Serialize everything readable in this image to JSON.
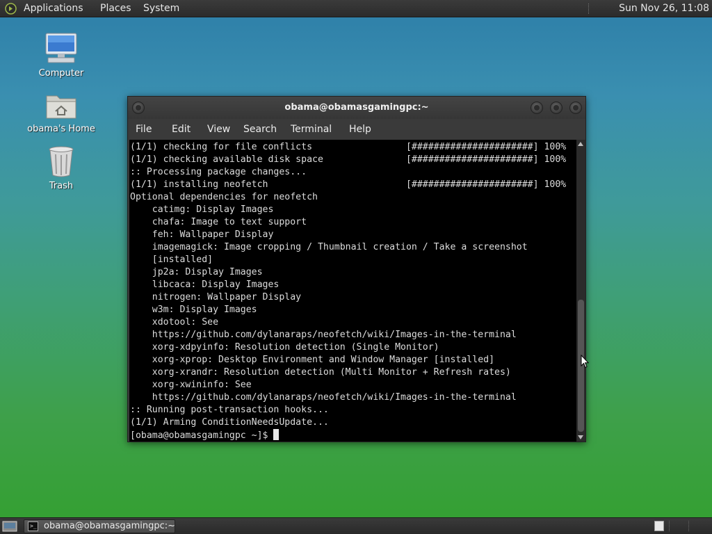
{
  "top_panel": {
    "menus": [
      "Applications",
      "Places",
      "System"
    ],
    "clock": "Sun Nov 26, 11:08"
  },
  "desktop_icons": [
    {
      "label": "Computer",
      "icon": "computer-icon"
    },
    {
      "label": "obama's Home",
      "icon": "home-folder-icon"
    },
    {
      "label": "Trash",
      "icon": "trash-icon"
    }
  ],
  "terminal": {
    "title": "obama@obamasgamingpc:~",
    "menu": [
      "File",
      "Edit",
      "View",
      "Search",
      "Terminal",
      "Help"
    ],
    "lines": [
      "(1/1) checking for file conflicts                 [######################] 100%",
      "(1/1) checking available disk space               [######################] 100%",
      ":: Processing package changes...",
      "(1/1) installing neofetch                         [######################] 100%",
      "Optional dependencies for neofetch",
      "    catimg: Display Images",
      "    chafa: Image to text support",
      "    feh: Wallpaper Display",
      "    imagemagick: Image cropping / Thumbnail creation / Take a screenshot",
      "    [installed]",
      "    jp2a: Display Images",
      "    libcaca: Display Images",
      "    nitrogen: Wallpaper Display",
      "    w3m: Display Images",
      "    xdotool: See",
      "    https://github.com/dylanaraps/neofetch/wiki/Images-in-the-terminal",
      "    xorg-xdpyinfo: Resolution detection (Single Monitor)",
      "    xorg-xprop: Desktop Environment and Window Manager [installed]",
      "    xorg-xrandr: Resolution detection (Multi Monitor + Refresh rates)",
      "    xorg-xwininfo: See",
      "    https://github.com/dylanaraps/neofetch/wiki/Images-in-the-terminal",
      ":: Running post-transaction hooks...",
      "(1/1) Arming ConditionNeedsUpdate..."
    ],
    "prompt": "[obama@obamasgamingpc ~]$ "
  },
  "taskbar": {
    "task_label": "obama@obamasgamingpc:~",
    "task_icon_glyph": ">_"
  }
}
